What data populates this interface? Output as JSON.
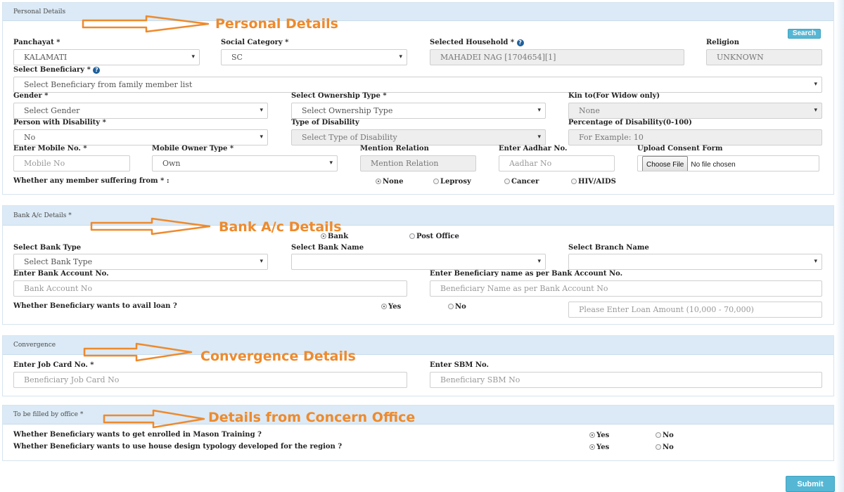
{
  "personal": {
    "header": "Personal Details",
    "annotation": "Personal Details",
    "search_button": "Search",
    "panchayat": {
      "label": "Panchayat *",
      "value": "KALAMATI"
    },
    "social_category": {
      "label": "Social Category *",
      "value": "SC"
    },
    "selected_household": {
      "label": "Selected Household *",
      "value": "MAHADEI NAG [1704654][1]"
    },
    "religion": {
      "label": "Religion",
      "value": "UNKNOWN"
    },
    "beneficiary": {
      "label": "Select Beneficiary *",
      "value": "Select Beneficiary from family member list"
    },
    "gender": {
      "label": "Gender *",
      "value": "Select Gender"
    },
    "ownership_type": {
      "label": "Select Ownership Type *",
      "value": "Select Ownership Type"
    },
    "kin_to": {
      "label": "Kin to(For Widow only)",
      "value": "None"
    },
    "disability": {
      "label": "Person with Disability *",
      "value": "No"
    },
    "disability_type": {
      "label": "Type of Disability",
      "value": "Select Type of Disability"
    },
    "disability_pct": {
      "label": "Percentage of Disability(0-100)",
      "placeholder": "For Example: 10"
    },
    "mobile": {
      "label": "Enter Mobile No. *",
      "placeholder": "Mobile No"
    },
    "mobile_owner": {
      "label": "Mobile Owner Type *",
      "value": "Own"
    },
    "relation": {
      "label": "Mention Relation",
      "placeholder": "Mention Relation"
    },
    "aadhar": {
      "label": "Enter Aadhar No.",
      "placeholder": "Aadhar No"
    },
    "consent": {
      "label": "Upload Consent Form",
      "button": "Choose File",
      "status": "No file chosen"
    },
    "suffering": {
      "label": "Whether any member suffering from * :",
      "options": [
        "None",
        "Leprosy",
        "Cancer",
        "HIV/AIDS"
      ],
      "selected": "None"
    }
  },
  "bank": {
    "header": "Bank A/c Details *",
    "annotation": "Bank A/c Details",
    "account_kind": {
      "options": [
        "Bank",
        "Post Office"
      ],
      "selected": "Bank"
    },
    "bank_type": {
      "label": "Select Bank Type",
      "value": "Select Bank Type"
    },
    "bank_name": {
      "label": "Select Bank Name",
      "value": ""
    },
    "branch_name": {
      "label": "Select Branch Name",
      "value": ""
    },
    "account_no": {
      "label": "Enter Bank Account No.",
      "placeholder": "Bank Account No"
    },
    "beneficiary_name": {
      "label": "Enter Beneficiary name as per Bank Account No.",
      "placeholder": "Beneficiary Name as per Bank Account No"
    },
    "loan": {
      "label": "Whether Beneficiary wants to avail loan ?",
      "options": [
        "Yes",
        "No"
      ],
      "selected": "Yes",
      "placeholder": "Please Enter Loan Amount (10,000 - 70,000)"
    }
  },
  "convergence": {
    "header": "Convergence",
    "annotation": "Convergence Details",
    "job_card": {
      "label": "Enter Job Card No. *",
      "placeholder": "Beneficiary Job Card No"
    },
    "sbm": {
      "label": "Enter SBM No.",
      "placeholder": "Beneficiary SBM No"
    }
  },
  "office": {
    "header": "To be filled by office *",
    "annotation": "Details from Concern Office",
    "mason_training": {
      "label": "Whether Beneficiary wants to get enrolled in Mason Training ?",
      "options": [
        "Yes",
        "No"
      ],
      "selected": "Yes"
    },
    "house_design": {
      "label": "Whether Beneficiary wants to use house design typology developed for the region ?",
      "options": [
        "Yes",
        "No"
      ],
      "selected": "Yes"
    }
  },
  "submit_button": "Submit",
  "colors": {
    "annotation": "#ee8a2d",
    "panel_header": "#dbeaf6",
    "button": "#56b7d4"
  }
}
